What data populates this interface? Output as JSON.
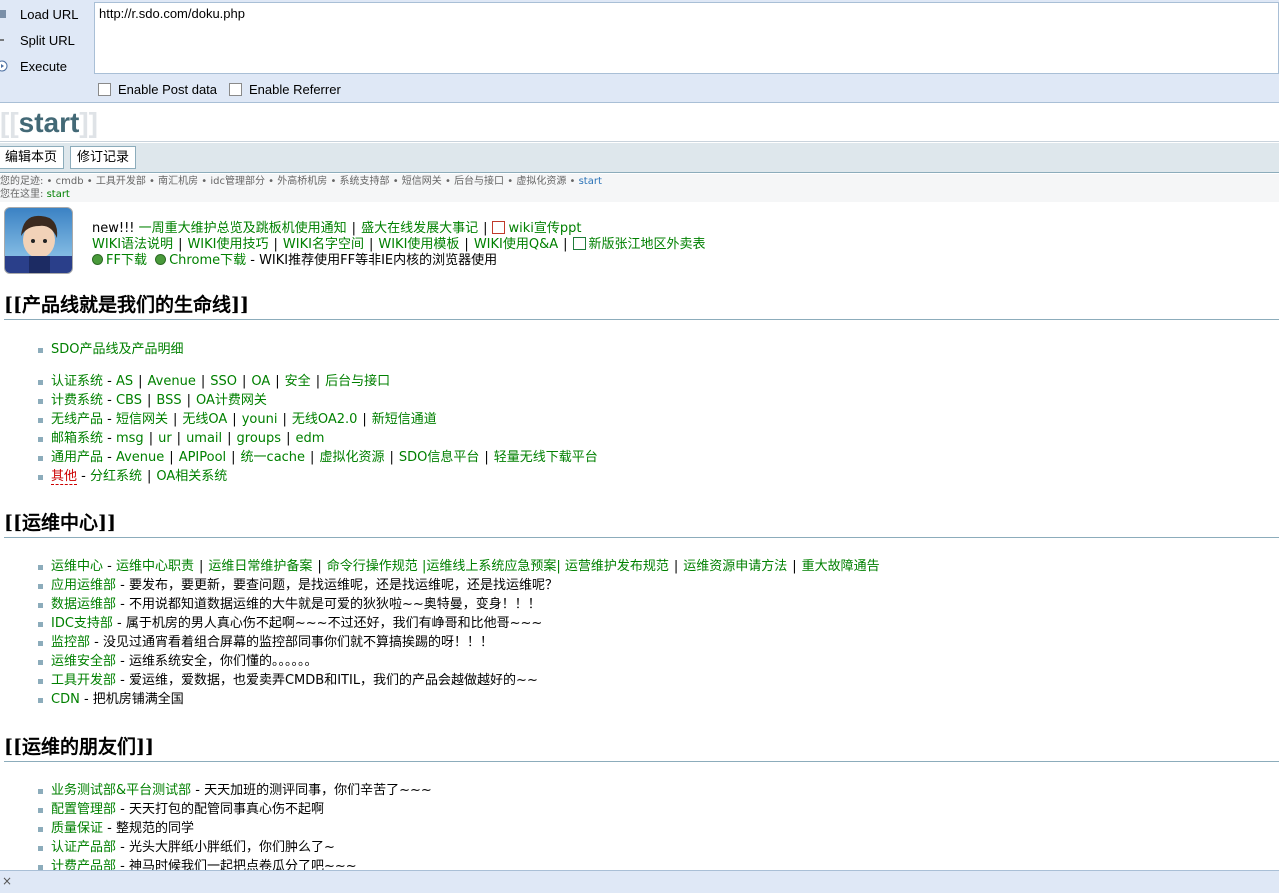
{
  "hackbar": {
    "load_label": "Load URL",
    "split_label": "Split URL",
    "execute_label": "Execute",
    "url_value": "http://r.sdo.com/doku.php",
    "post_label": "Enable Post data",
    "referrer_label": "Enable Referrer"
  },
  "page": {
    "title_open": "[[",
    "title": "start",
    "title_close": "]]"
  },
  "toolbar": {
    "edit_label": "编辑本页",
    "history_label": "修订记录"
  },
  "breadcrumbs": {
    "trace_label": "您的足迹:",
    "trace": [
      "cmdb",
      "工具开发部",
      "南汇机房",
      "idc管理部分",
      "外高桥机房",
      "系统支持部",
      "短信网关",
      "后台与接口",
      "虚拟化资源",
      "start"
    ],
    "here_label": "您在这里:",
    "here": "start"
  },
  "notice": {
    "new_prefix": "new!!!",
    "line1": [
      "一周重大维护总览及跳板机使用通知",
      "盛大在线发展大事记"
    ],
    "ppt": "wiki宣传ppt",
    "line2": [
      "WIKI语法说明",
      "WIKI使用技巧",
      "WIKI名字空间",
      "WIKI使用模板",
      "WIKI使用Q&A"
    ],
    "takeaway": "新版张江地区外卖表",
    "ff": "FF下载",
    "chrome": "Chrome下载",
    "browser_note": "WIKI推荐使用FF等非IE内核的浏览器使用"
  },
  "sections": [
    {
      "heading": "[[产品线就是我们的生命线]]"
    },
    {
      "heading": "[[运维中心]]"
    },
    {
      "heading": "[[运维的朋友们]]"
    }
  ],
  "products": {
    "single": "SDO产品线及产品明细",
    "rows": [
      {
        "cat": "认证系统",
        "items": [
          "AS",
          "Avenue",
          "SSO",
          "OA",
          "安全",
          "后台与接口"
        ]
      },
      {
        "cat": "计费系统",
        "items": [
          "CBS",
          "BSS",
          "OA计费网关"
        ]
      },
      {
        "cat": "无线产品",
        "items": [
          "短信网关",
          "无线OA",
          "youni",
          "无线OA2.0",
          "新短信通道"
        ]
      },
      {
        "cat": "邮箱系统",
        "items": [
          "msg",
          "ur",
          "umail",
          "groups",
          "edm"
        ]
      },
      {
        "cat": "通用产品",
        "items": [
          "Avenue",
          "APIPool",
          "统一cache",
          "虚拟化资源",
          "SDO信息平台",
          "轻量无线下载平台"
        ]
      },
      {
        "cat": "其他",
        "items": [
          "分红系统",
          "OA相关系统"
        ]
      }
    ]
  },
  "ops": {
    "first": {
      "cat": "运维中心",
      "items": [
        "运维中心职责",
        "运维日常维护备案",
        "命令行操作规范",
        "|运维线上系统应急预案|",
        "运营维护发布规范",
        "运维资源申请方法",
        "重大故障通告"
      ]
    },
    "rows": [
      {
        "cat": "应用运维部",
        "desc": "要发布，要更新，要查问题，是找运维呢，还是找运维呢，还是找运维呢？"
      },
      {
        "cat": "数据运维部",
        "desc": "不用说都知道数据运维的大牛就是可爱的狄狄啦~~奥特曼，变身！！！"
      },
      {
        "cat": "IDC支持部",
        "desc": "属于机房的男人真心伤不起啊~~~不过还好，我们有峥哥和比他哥~~~"
      },
      {
        "cat": "监控部",
        "desc": "没见过通宵看着组合屏幕的监控部同事你们就不算搞挨踢的呀！！！"
      },
      {
        "cat": "运维安全部",
        "desc": "运维系统安全，你们懂的。。。。。。"
      },
      {
        "cat": "工具开发部",
        "desc": "爱运维，爱数据，也爱卖弄CMDB和ITIL，我们的产品会越做越好的~~"
      },
      {
        "cat": "CDN",
        "desc": "把机房铺满全国"
      }
    ]
  },
  "friends": {
    "rows": [
      {
        "cat": "业务测试部&平台测试部",
        "desc": "天天加班的测评同事，你们辛苦了~~~"
      },
      {
        "cat": "配置管理部",
        "desc": "天天打包的配管同事真心伤不起啊"
      },
      {
        "cat": "质量保证",
        "desc": "整规范的同学"
      },
      {
        "cat": "认证产品部",
        "desc": "光头大胖纸小胖纸们，你们肿么了~"
      },
      {
        "cat": "计费产品部",
        "desc": "神马时候我们一起把点卷瓜分了吧~~~"
      }
    ]
  },
  "status": {
    "text": "×"
  }
}
